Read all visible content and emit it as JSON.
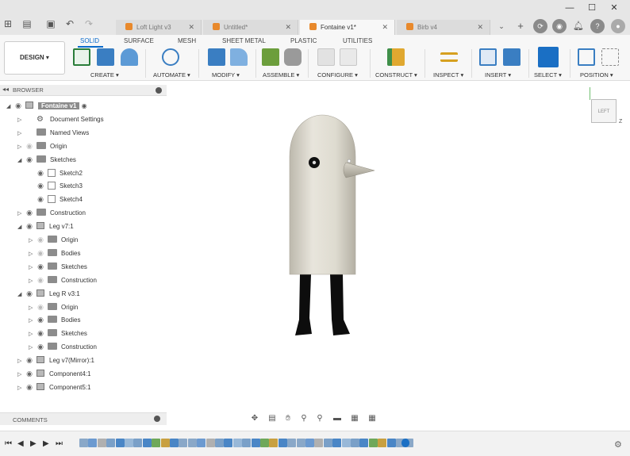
{
  "doc_tabs": [
    {
      "label": "Loft Light v3",
      "active": false
    },
    {
      "label": "Untitled*",
      "active": false
    },
    {
      "label": "Fontaine v1*",
      "active": true
    },
    {
      "label": "Birb v4",
      "active": false
    }
  ],
  "ribbon": {
    "workspace_button": "DESIGN ▾",
    "mode_tabs": [
      "SOLID",
      "SURFACE",
      "MESH",
      "SHEET METAL",
      "PLASTIC",
      "UTILITIES"
    ],
    "active_mode": "SOLID",
    "groups": [
      "CREATE ▾",
      "AUTOMATE ▾",
      "MODIFY ▾",
      "ASSEMBLE ▾",
      "CONFIGURE ▾",
      "CONSTRUCT ▾",
      "INSPECT ▾",
      "INSERT ▾",
      "SELECT ▾",
      "POSITION ▾"
    ]
  },
  "browser": {
    "title": "BROWSER",
    "rows": [
      {
        "label": "Fontaine v1",
        "indent": 0,
        "type": "root",
        "tri": "◢"
      },
      {
        "label": "Document Settings",
        "indent": 1,
        "type": "gear",
        "tri": "▷"
      },
      {
        "label": "Named Views",
        "indent": 1,
        "type": "folder",
        "tri": "▷",
        "noeye": true
      },
      {
        "label": "Origin",
        "indent": 1,
        "type": "folder",
        "tri": "▷",
        "dim": true
      },
      {
        "label": "Sketches",
        "indent": 1,
        "type": "folder",
        "tri": "◢"
      },
      {
        "label": "Sketch2",
        "indent": 2,
        "type": "sketch",
        "tri": ""
      },
      {
        "label": "Sketch3",
        "indent": 2,
        "type": "sketch",
        "tri": ""
      },
      {
        "label": "Sketch4",
        "indent": 2,
        "type": "sketch",
        "tri": ""
      },
      {
        "label": "Construction",
        "indent": 1,
        "type": "folder",
        "tri": "▷"
      },
      {
        "label": "Leg v7:1",
        "indent": 1,
        "type": "comp",
        "tri": "◢"
      },
      {
        "label": "Origin",
        "indent": 2,
        "type": "folder",
        "tri": "▷",
        "dim": true
      },
      {
        "label": "Bodies",
        "indent": 2,
        "type": "folder",
        "tri": "▷",
        "dim": true
      },
      {
        "label": "Sketches",
        "indent": 2,
        "type": "folder",
        "tri": "▷"
      },
      {
        "label": "Construction",
        "indent": 2,
        "type": "folder",
        "tri": "▷",
        "dim": true
      },
      {
        "label": "Leg R v3:1",
        "indent": 1,
        "type": "comp",
        "tri": "◢"
      },
      {
        "label": "Origin",
        "indent": 2,
        "type": "folder",
        "tri": "▷",
        "dim": true
      },
      {
        "label": "Bodies",
        "indent": 2,
        "type": "folder",
        "tri": "▷"
      },
      {
        "label": "Sketches",
        "indent": 2,
        "type": "folder",
        "tri": "▷"
      },
      {
        "label": "Construction",
        "indent": 2,
        "type": "folder",
        "tri": "▷"
      },
      {
        "label": "Leg v7(Mirror):1",
        "indent": 1,
        "type": "comp",
        "tri": "▷"
      },
      {
        "label": "Component4:1",
        "indent": 1,
        "type": "comp",
        "tri": "▷"
      },
      {
        "label": "Component5:1",
        "indent": 1,
        "type": "comp",
        "tri": "▷"
      }
    ]
  },
  "comments": {
    "title": "COMMENTS"
  },
  "viewcube": {
    "face": "LEFT",
    "axis_z": "Z"
  },
  "colors": {
    "accent": "#0b6bcb",
    "body": "#d9d6cc",
    "legs": "#0d0d0d"
  }
}
